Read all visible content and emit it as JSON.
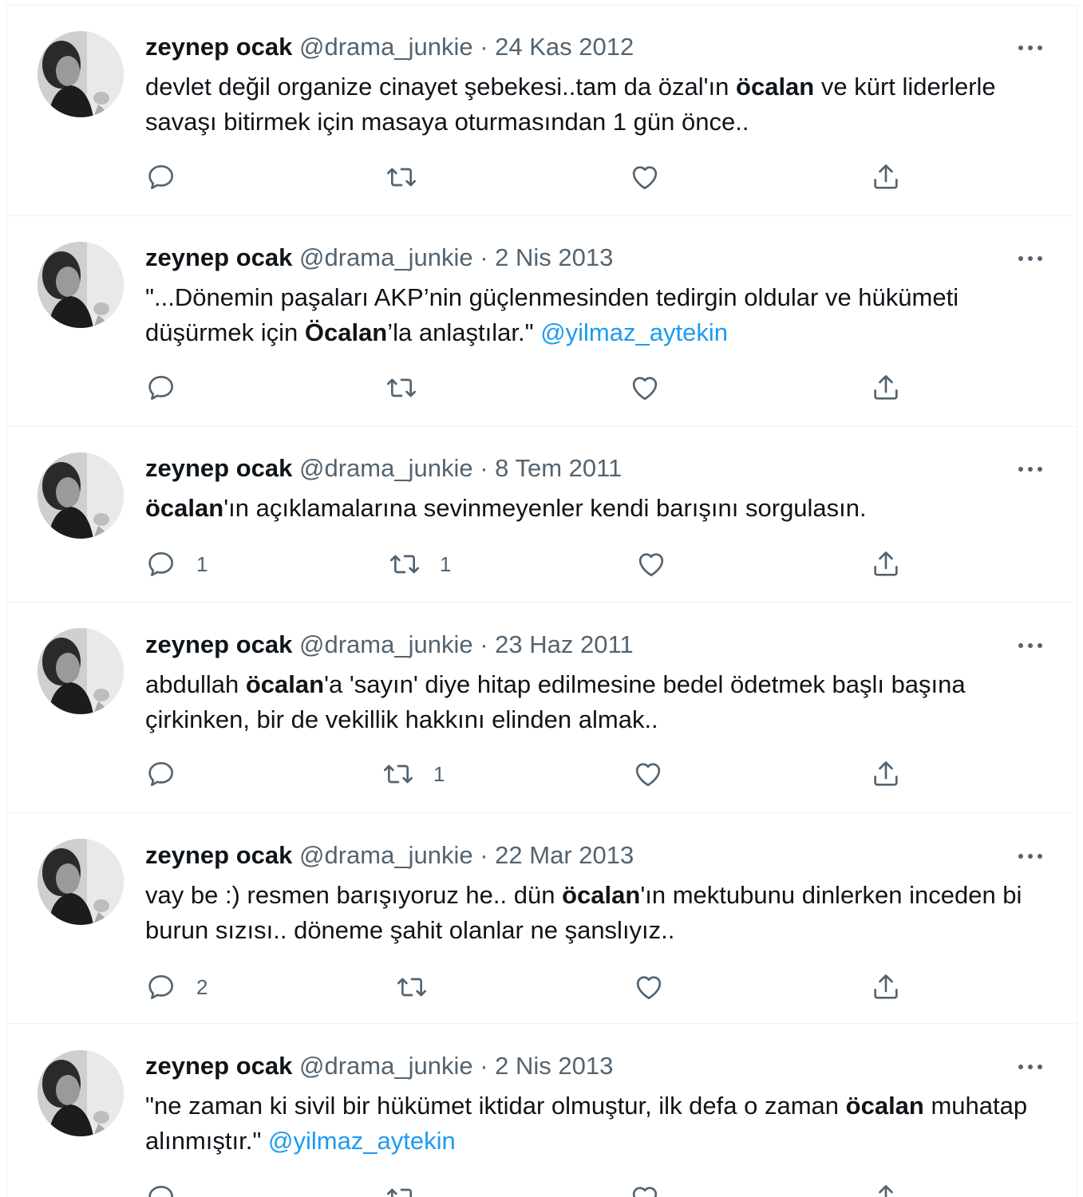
{
  "tweets": [
    {
      "name": "zeynep ocak",
      "handle": "@drama_junkie",
      "sep": "·",
      "date": "24 Kas 2012",
      "text": [
        {
          "t": "devlet değil organize cinayet şebekesi..tam da özal'ın "
        },
        {
          "t": "öcalan",
          "b": true
        },
        {
          "t": " ve kürt liderlerle savaşı bitirmek için masaya oturmasından 1 gün önce.."
        }
      ],
      "replies": "",
      "retweets": "",
      "likes": ""
    },
    {
      "name": "zeynep ocak",
      "handle": "@drama_junkie",
      "sep": "·",
      "date": "2 Nis 2013",
      "text": [
        {
          "t": "\"...Dönemin paşaları AKP’nin güçlenmesinden tedirgin oldular ve hükümeti düşürmek için "
        },
        {
          "t": "Öcalan",
          "b": true
        },
        {
          "t": "’la anlaştılar.\" "
        },
        {
          "t": "@yilmaz_aytekin",
          "m": true
        }
      ],
      "replies": "",
      "retweets": "",
      "likes": ""
    },
    {
      "name": "zeynep ocak",
      "handle": "@drama_junkie",
      "sep": "·",
      "date": "8 Tem 2011",
      "text": [
        {
          "t": "öcalan",
          "b": true
        },
        {
          "t": "'ın açıklamalarına sevinmeyenler kendi barışını sorgulasın."
        }
      ],
      "replies": "1",
      "retweets": "1",
      "likes": ""
    },
    {
      "name": "zeynep ocak",
      "handle": "@drama_junkie",
      "sep": "·",
      "date": "23 Haz 2011",
      "text": [
        {
          "t": "abdullah "
        },
        {
          "t": "öcalan",
          "b": true
        },
        {
          "t": "'a 'sayın' diye hitap edilmesine bedel ödetmek başlı başına çirkinken, bir de vekillik hakkını elinden almak.."
        }
      ],
      "replies": "",
      "retweets": "1",
      "likes": ""
    },
    {
      "name": "zeynep ocak",
      "handle": "@drama_junkie",
      "sep": "·",
      "date": "22 Mar 2013",
      "text": [
        {
          "t": "vay be :) resmen barışıyoruz he.. dün "
        },
        {
          "t": "öcalan",
          "b": true
        },
        {
          "t": "'ın mektubunu dinlerken inceden bi burun sızısı.. döneme şahit olanlar ne şanslıyız.."
        }
      ],
      "replies": "2",
      "retweets": "",
      "likes": ""
    },
    {
      "name": "zeynep ocak",
      "handle": "@drama_junkie",
      "sep": "·",
      "date": "2 Nis 2013",
      "text": [
        {
          "t": "\"ne zaman ki sivil bir hükümet iktidar olmuştur, ilk defa o zaman "
        },
        {
          "t": "öcalan",
          "b": true
        },
        {
          "t": " muhatap alınmıştır.\" "
        },
        {
          "t": "@yilmaz_aytekin",
          "m": true
        }
      ],
      "replies": "",
      "retweets": "",
      "likes": ""
    }
  ],
  "colors": {
    "text": "#0f1419",
    "secondary": "#536471",
    "mention": "#1d9bf0",
    "border": "#eff3f4"
  },
  "icons": {
    "reply": "reply-icon",
    "retweet": "retweet-icon",
    "like": "like-icon",
    "share": "share-icon",
    "more": "more-icon"
  }
}
